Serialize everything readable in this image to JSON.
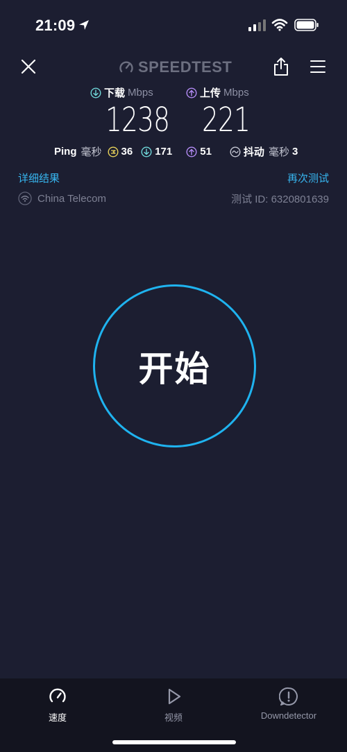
{
  "status_bar": {
    "time": "21:09"
  },
  "header": {
    "logo_text": "SPEEDTEST"
  },
  "results": {
    "download": {
      "label": "下载",
      "unit": "Mbps",
      "value": "1238"
    },
    "upload": {
      "label": "上传",
      "unit": "Mbps",
      "value": "221"
    },
    "ping": {
      "label": "Ping",
      "unit": "毫秒",
      "idle": "36",
      "download": "171",
      "upload": "51"
    },
    "jitter": {
      "label": "抖动",
      "unit": "毫秒",
      "value": "3"
    }
  },
  "links": {
    "details": "详细结果",
    "retest": "再次测试"
  },
  "connection": {
    "isp": "China Telecom",
    "test_id": "测试 ID: 6320801639"
  },
  "start_button": {
    "label": "开始"
  },
  "tabs": [
    {
      "label": "速度",
      "icon": "speedometer-icon",
      "active": true
    },
    {
      "label": "视频",
      "icon": "play-icon",
      "active": false
    },
    {
      "label": "Downdetector",
      "icon": "alert-icon",
      "active": false
    }
  ],
  "colors": {
    "background": "#1c1e31",
    "accent": "#1fb3ef",
    "download": "#6fd6d8",
    "upload": "#b38bf5",
    "ping_idle": "#e8d35a"
  }
}
